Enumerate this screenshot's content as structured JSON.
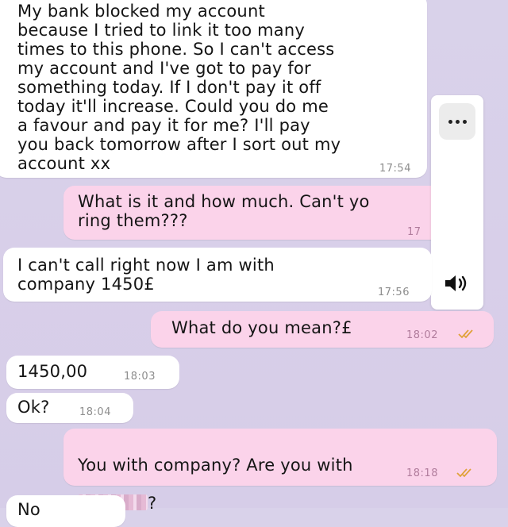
{
  "messages": [
    {
      "id": "m1",
      "direction": "incoming",
      "text": "My bank blocked my account\nbecause I tried to link it too many\ntimes to this phone. So I can't access\nmy account and I've got to pay for\nsomething today. If I don't pay it off\ntoday it'll increase. Could you do me\na favour and pay it for me? I'll pay\nyou back tomorrow after I sort out my\naccount xx",
      "time": "17:54"
    },
    {
      "id": "m2",
      "direction": "outgoing",
      "text": "What is it and how much. Can't yo\nring them???",
      "time": "17"
    },
    {
      "id": "m3",
      "direction": "incoming",
      "text": "I can't call right now I am with\ncompany 1450£",
      "time": "17:56"
    },
    {
      "id": "m4",
      "direction": "outgoing",
      "text": "What do you mean?£",
      "time": "18:02",
      "status": "read"
    },
    {
      "id": "m5",
      "direction": "incoming",
      "text": "1450,00",
      "time": "18:03"
    },
    {
      "id": "m6",
      "direction": "incoming",
      "text": "Ok?",
      "time": "18:04"
    },
    {
      "id": "m7",
      "direction": "outgoing",
      "text_line1": "You with company? Are you with",
      "text_line2_suffix": "?",
      "time": "18:18",
      "status": "read"
    },
    {
      "id": "m8",
      "direction": "incoming",
      "text": "No"
    }
  ],
  "panel": {
    "menu_icon": "more-dots-icon",
    "audio_icon": "speaker-volume-icon"
  },
  "colors": {
    "background": "#d9d2ea",
    "incoming_bubble": "#ffffff",
    "outgoing_bubble": "#fbd3ea",
    "read_ticks": "#e0a23a"
  }
}
